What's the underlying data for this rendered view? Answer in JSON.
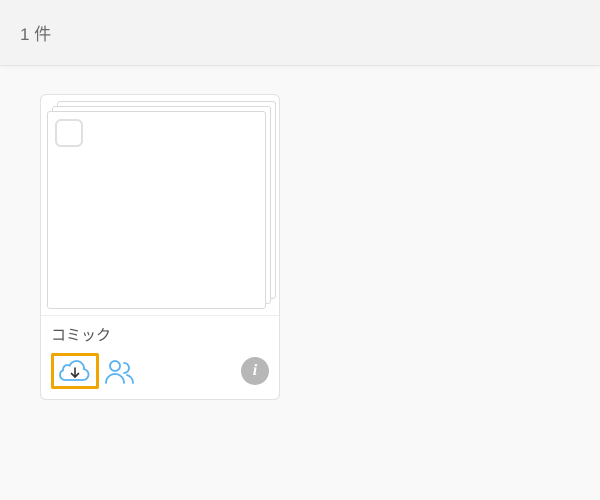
{
  "header": {
    "count_label": "1 件"
  },
  "item": {
    "title": "コミック"
  },
  "icons": {
    "download": "cloud-download-icon",
    "share": "people-icon",
    "info": "info-icon"
  },
  "colors": {
    "accent_blue": "#57b3f2",
    "highlight_orange": "#f0a500",
    "muted_gray": "#b7b7b7"
  }
}
